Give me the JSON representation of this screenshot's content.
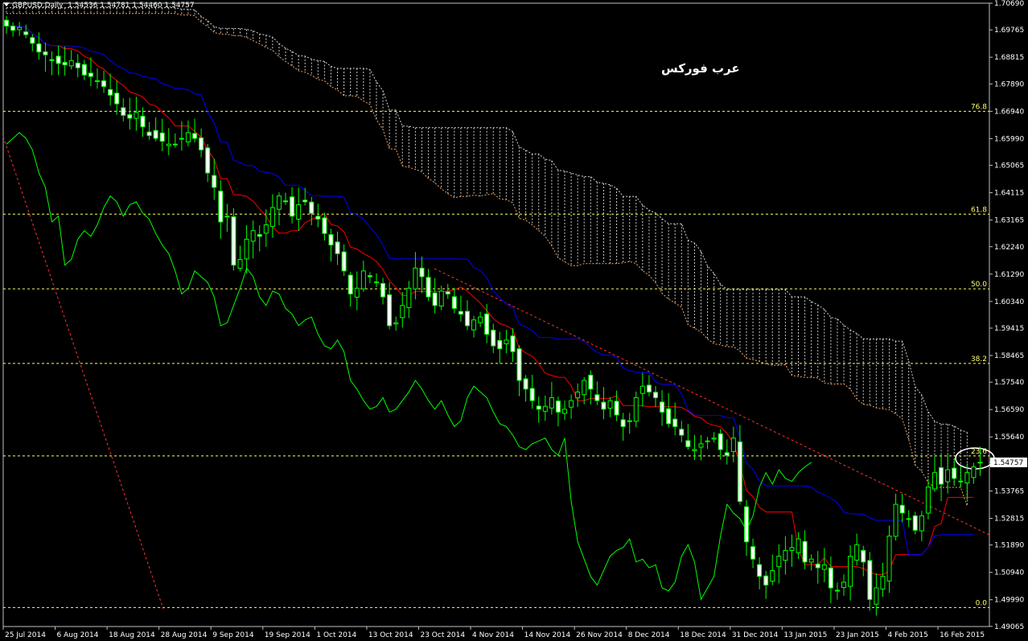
{
  "header": {
    "symbol": "GBPUSD,Daily",
    "quotes": "1.54536 1.54781 1.54460 1.54757"
  },
  "watermark": "عرب فوركس",
  "chart_data": {
    "type": "candlestick",
    "ylim": [
      1.4906,
      1.7069
    ],
    "price_ticks": [
      "1.70690",
      "1.69765",
      "1.68815",
      "1.67890",
      "1.66940",
      "1.65990",
      "1.65065",
      "1.64115",
      "1.63165",
      "1.62240",
      "1.61290",
      "1.60340",
      "1.59415",
      "1.58465",
      "1.57540",
      "1.56590",
      "1.55640",
      "1.54757",
      "1.53765",
      "1.52815",
      "1.51890",
      "1.50940",
      "1.49990",
      "1.49065"
    ],
    "current_price": "1.54757",
    "date_ticks": [
      {
        "label": "25 Jul 2014",
        "i": 0
      },
      {
        "label": "6 Aug 2014",
        "i": 8
      },
      {
        "label": "18 Aug 2014",
        "i": 16
      },
      {
        "label": "28 Aug 2014",
        "i": 24
      },
      {
        "label": "9 Sep 2014",
        "i": 32
      },
      {
        "label": "19 Sep 2014",
        "i": 40
      },
      {
        "label": "1 Oct 2014",
        "i": 48
      },
      {
        "label": "13 Oct 2014",
        "i": 56
      },
      {
        "label": "23 Oct 2014",
        "i": 64
      },
      {
        "label": "4 Nov 2014",
        "i": 72
      },
      {
        "label": "14 Nov 2014",
        "i": 80
      },
      {
        "label": "26 Nov 2014",
        "i": 88
      },
      {
        "label": "8 Dec 2014",
        "i": 96
      },
      {
        "label": "18 Dec 2014",
        "i": 104
      },
      {
        "label": "31 Dec 2014",
        "i": 112
      },
      {
        "label": "13 Jan 2015",
        "i": 120
      },
      {
        "label": "23 Jan 2015",
        "i": 128
      },
      {
        "label": "4 Feb 2015",
        "i": 136
      },
      {
        "label": "16 Feb 2015",
        "i": 144
      }
    ],
    "fibonacci": [
      {
        "label": "76.8",
        "price": 1.6694
      },
      {
        "label": "61.8",
        "price": 1.6337
      },
      {
        "label": "50.0",
        "price": 1.6078
      },
      {
        "label": "38.2",
        "price": 1.5819
      },
      {
        "label": "23.6",
        "price": 1.5498
      },
      {
        "label": "0.0",
        "price": 1.4972
      }
    ],
    "closes": [
      1.699,
      1.6975,
      1.6985,
      1.696,
      1.693,
      1.69,
      1.689,
      1.687,
      1.686,
      1.6855,
      1.687,
      1.6845,
      1.682,
      1.6815,
      1.68,
      1.678,
      1.675,
      1.672,
      1.668,
      1.667,
      1.669,
      1.664,
      1.661,
      1.66,
      1.659,
      1.658,
      1.658,
      1.66,
      1.662,
      1.66,
      1.656,
      1.648,
      1.643,
      1.631,
      1.633,
      1.616,
      1.618,
      1.625,
      1.628,
      1.626,
      1.63,
      1.636,
      1.64,
      1.638,
      1.633,
      1.637,
      1.638,
      1.634,
      1.632,
      1.627,
      1.623,
      1.62,
      1.614,
      1.606,
      1.608,
      1.614,
      1.612,
      1.61,
      1.605,
      1.595,
      1.596,
      1.602,
      1.608,
      1.615,
      1.612,
      1.605,
      1.602,
      1.607,
      1.606,
      1.601,
      1.599,
      1.595,
      1.597,
      1.598,
      1.592,
      1.588,
      1.587,
      1.59,
      1.586,
      1.576,
      1.573,
      1.569,
      1.566,
      1.567,
      1.57,
      1.565,
      1.566,
      1.569,
      1.572,
      1.576,
      1.573,
      1.569,
      1.566,
      1.569,
      1.564,
      1.56,
      1.562,
      1.57,
      1.574,
      1.572,
      1.57,
      1.565,
      1.561,
      1.56,
      1.557,
      1.553,
      1.552,
      1.554,
      1.555,
      1.556,
      1.552,
      1.55,
      1.556,
      1.534,
      1.52,
      1.514,
      1.508,
      1.505,
      1.51,
      1.515,
      1.517,
      1.518,
      1.521,
      1.513,
      1.514,
      1.511,
      1.512,
      1.504,
      1.503,
      1.506,
      1.515,
      1.519,
      1.513,
      1.5,
      1.504,
      1.508,
      1.522,
      1.533,
      1.53,
      1.528,
      1.524,
      1.529,
      1.539,
      1.544,
      1.54,
      1.545,
      1.542,
      1.541,
      1.544,
      1.546,
      1.5476
    ]
  }
}
